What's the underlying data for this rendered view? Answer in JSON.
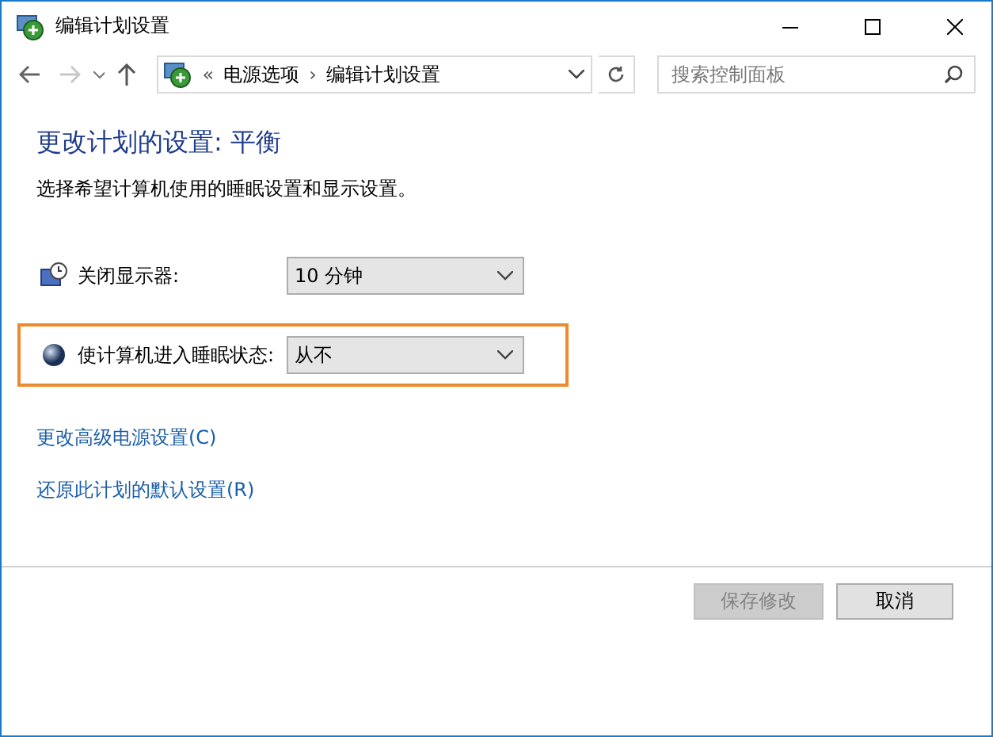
{
  "window": {
    "title": "编辑计划设置"
  },
  "nav": {
    "back_disabled": false,
    "forward_disabled": true,
    "breadcrumb_prefix": "«",
    "breadcrumbs": [
      "电源选项",
      "编辑计划设置"
    ],
    "separator": "›"
  },
  "search": {
    "placeholder": "搜索控制面板"
  },
  "heading": "更改计划的设置: 平衡",
  "description": "选择希望计算机使用的睡眠设置和显示设置。",
  "settings": [
    {
      "kind": "display",
      "label": "关闭显示器:",
      "value": "10 分钟",
      "highlighted": false
    },
    {
      "kind": "sleep",
      "label": "使计算机进入睡眠状态:",
      "value": "从不",
      "highlighted": true
    }
  ],
  "links": [
    "更改高级电源设置(C)",
    "还原此计划的默认设置(R)"
  ],
  "buttons": [
    {
      "label": "保存修改",
      "disabled": true
    },
    {
      "label": "取消",
      "disabled": false
    }
  ]
}
